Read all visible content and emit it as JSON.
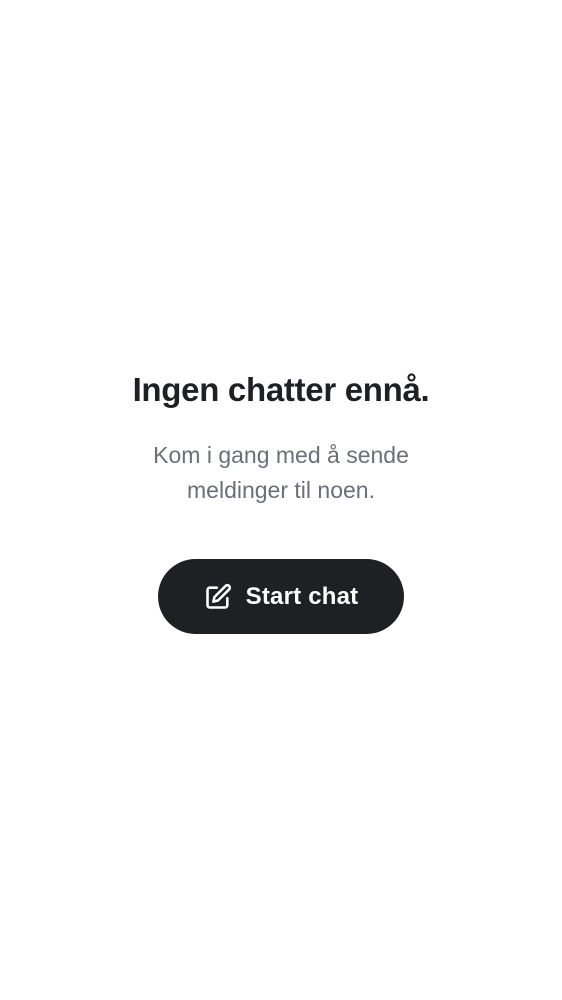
{
  "empty_state": {
    "title": "Ingen chatter ennå.",
    "subtitle": "Kom i gang med å sende meldinger til noen.",
    "start_button": {
      "label": "Start chat",
      "icon": "edit-icon"
    }
  },
  "colors": {
    "background": "#ffffff",
    "title_text": "#1f2024",
    "subtitle_text": "#6b6f78",
    "button_background": "#1f2024",
    "button_text": "#ffffff"
  }
}
